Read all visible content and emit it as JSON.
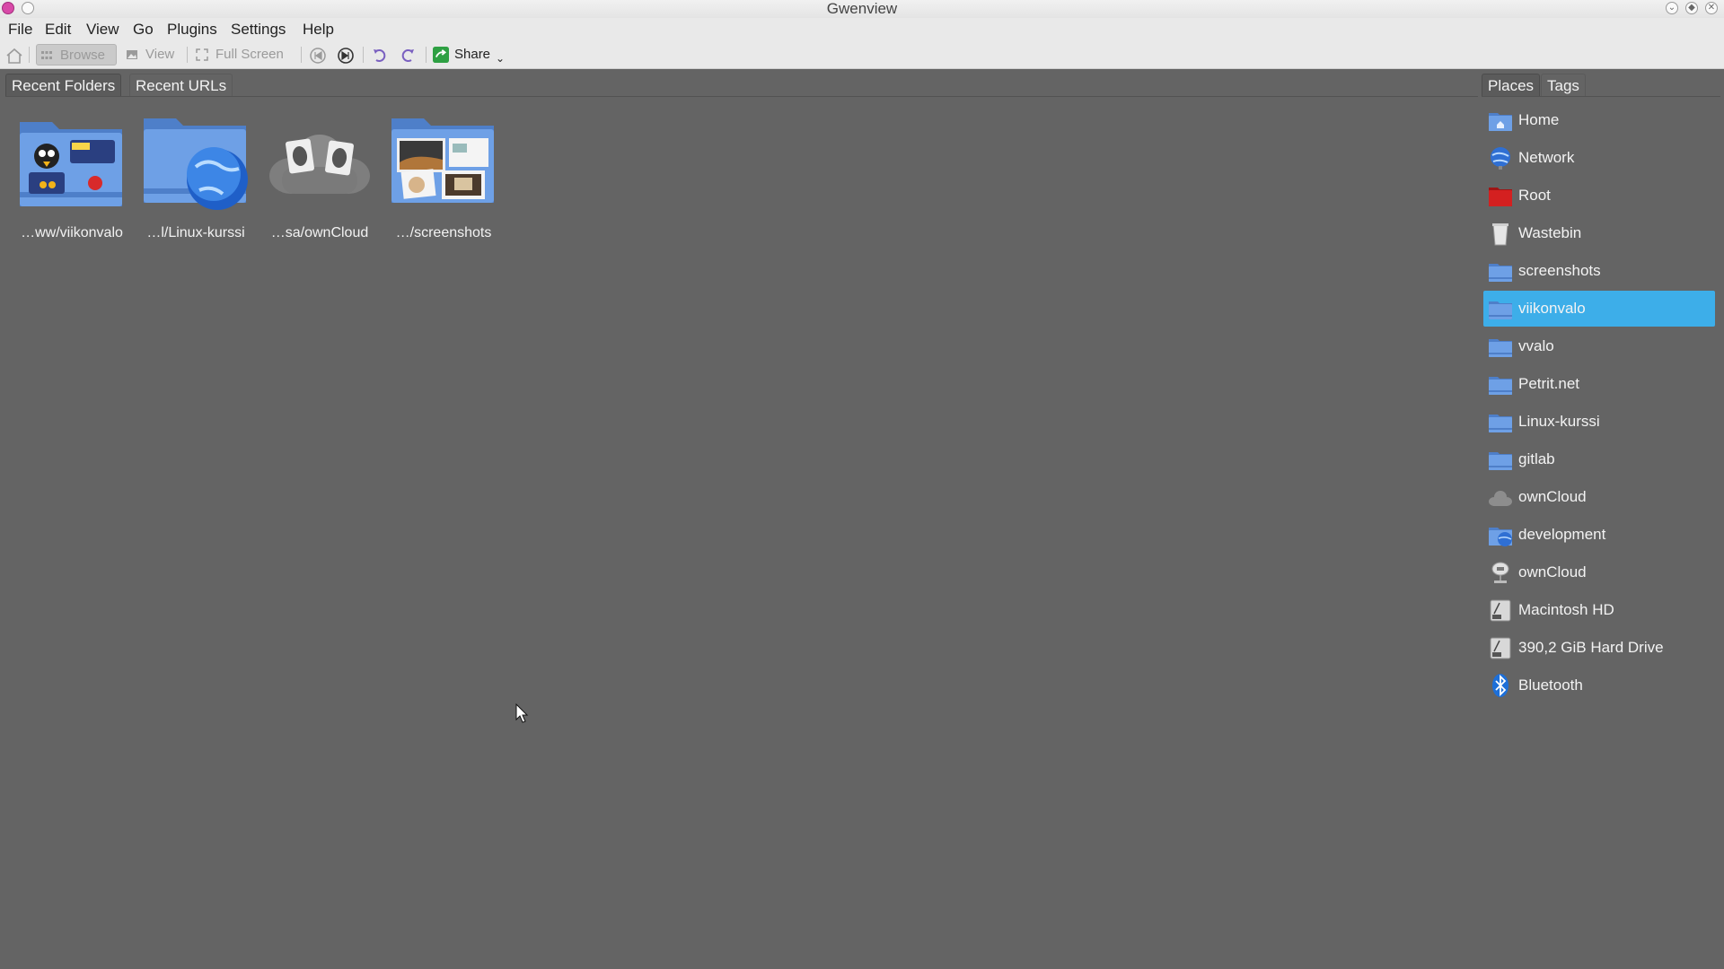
{
  "window": {
    "title": "Gwenview"
  },
  "menubar": {
    "items": [
      {
        "label": "File"
      },
      {
        "label": "Edit"
      },
      {
        "label": "View"
      },
      {
        "label": "Go"
      },
      {
        "label": "Plugins"
      },
      {
        "label": "Settings"
      },
      {
        "label": "Help"
      }
    ]
  },
  "toolbar": {
    "browse_label": "Browse",
    "view_label": "View",
    "fullscreen_label": "Full Screen",
    "share_label": "Share"
  },
  "left_tabs": [
    {
      "label": "Recent Folders"
    },
    {
      "label": "Recent URLs"
    }
  ],
  "recent_folders": [
    {
      "label": "…ww/viikonvalo"
    },
    {
      "label": "…l/Linux-kurssi"
    },
    {
      "label": "…sa/ownCloud"
    },
    {
      "label": "…/screenshots"
    }
  ],
  "right_tabs": [
    {
      "label": "Places"
    },
    {
      "label": "Tags"
    }
  ],
  "places": [
    {
      "label": "Home",
      "icon": "home-folder-icon"
    },
    {
      "label": "Network",
      "icon": "network-globe-icon"
    },
    {
      "label": "Root",
      "icon": "red-folder-icon"
    },
    {
      "label": "Wastebin",
      "icon": "trash-icon"
    },
    {
      "label": "screenshots",
      "icon": "folder-icon"
    },
    {
      "label": "viikonvalo",
      "icon": "folder-icon",
      "selected": true
    },
    {
      "label": "vvalo",
      "icon": "folder-icon"
    },
    {
      "label": "Petrit.net",
      "icon": "folder-icon"
    },
    {
      "label": "Linux-kurssi",
      "icon": "folder-icon"
    },
    {
      "label": "gitlab",
      "icon": "folder-icon"
    },
    {
      "label": "ownCloud",
      "icon": "cloud-icon"
    },
    {
      "label": "development",
      "icon": "folder-globe-icon"
    },
    {
      "label": "ownCloud",
      "icon": "network-drive-icon"
    },
    {
      "label": "Macintosh HD",
      "icon": "hard-drive-icon"
    },
    {
      "label": "390,2 GiB Hard Drive",
      "icon": "hard-drive-icon"
    },
    {
      "label": "Bluetooth",
      "icon": "bluetooth-icon"
    }
  ],
  "colors": {
    "background": "#646464",
    "selection": "#3daee9",
    "folder": "#5b8fd8"
  }
}
